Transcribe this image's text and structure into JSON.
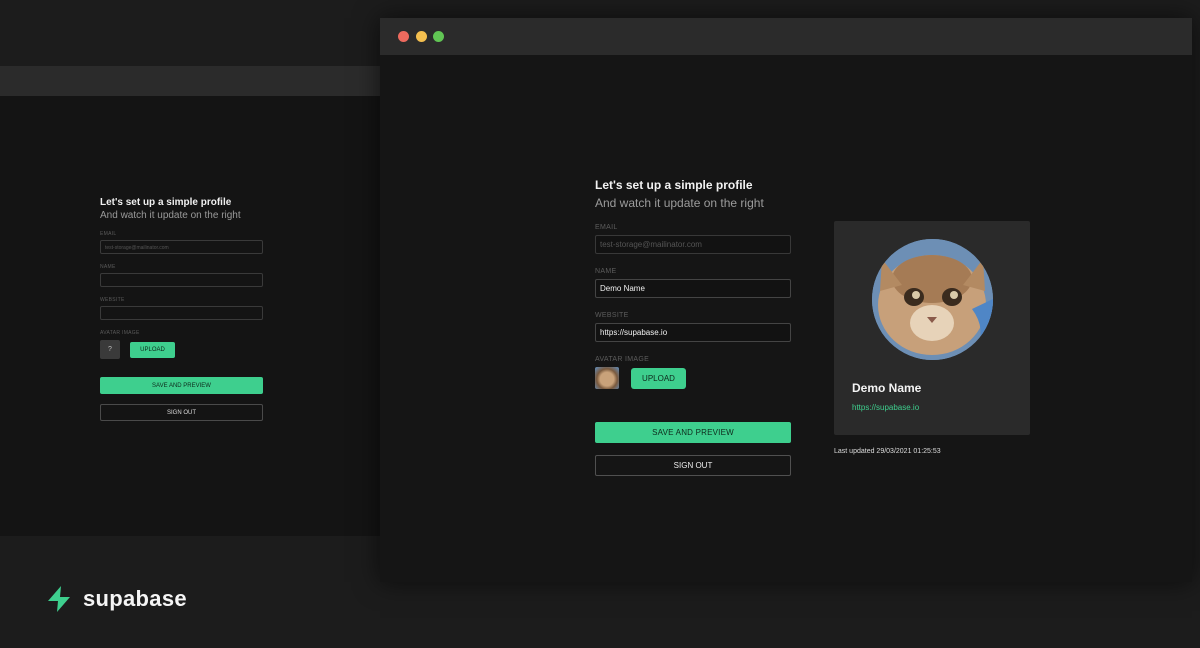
{
  "back_window": {
    "heading": "Let's set up a simple profile",
    "subheading": "And watch it update on the right",
    "email_label": "EMAIL",
    "email_value": "test-storage@mailinator.com",
    "name_label": "NAME",
    "website_label": "WEBSITE",
    "avatar_label": "AVATAR IMAGE",
    "avatar_placeholder": "?",
    "upload_label": "UPLOAD",
    "save_label": "SAVE AND PREVIEW",
    "signout_label": "SIGN OUT"
  },
  "front_window": {
    "heading": "Let's set up a simple profile",
    "subheading": "And watch it update on the right",
    "email_label": "EMAIL",
    "email_value": "test-storage@mailinator.com",
    "name_label": "NAME",
    "name_value": "Demo Name",
    "website_label": "WEBSITE",
    "website_value": "https://supabase.io",
    "avatar_label": "AVATAR IMAGE",
    "upload_label": "UPLOAD",
    "save_label": "SAVE AND PREVIEW",
    "signout_label": "SIGN OUT"
  },
  "preview_card": {
    "name": "Demo Name",
    "website": "https://supabase.io",
    "last_updated": "Last updated 29/03/2021 01:25:53"
  },
  "brand": {
    "name": "supabase",
    "accent_color": "#3ecf8e"
  },
  "icons": {
    "logo": "supabase-bolt-icon",
    "window_controls": [
      "close-dot",
      "minimize-dot",
      "zoom-dot"
    ]
  }
}
